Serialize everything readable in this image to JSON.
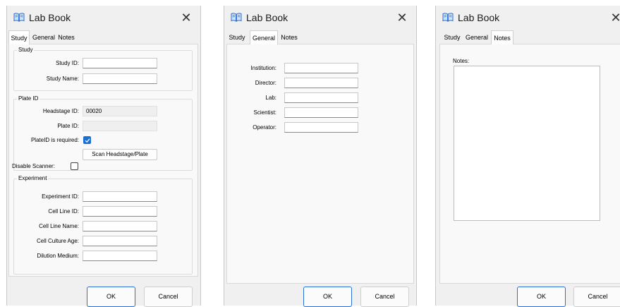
{
  "title": "Lab Book",
  "tabs": [
    "Study",
    "General",
    "Notes"
  ],
  "buttons": {
    "ok": "OK",
    "cancel": "Cancel"
  },
  "study_tab": {
    "study_group": {
      "title": "Study",
      "study_id_label": "Study ID:",
      "study_name_label": "Study Name:",
      "study_id_value": "",
      "study_name_value": ""
    },
    "plate_group": {
      "title": "Plate ID",
      "headstage_id_label": "Headstage ID:",
      "headstage_id_value": "00020",
      "plate_id_label": "Plate ID:",
      "plate_id_value": "",
      "plateid_required_label": "PlateID is required:",
      "plateid_required_checked": true,
      "scan_button": "Scan Headstage/Plate"
    },
    "disable_scanner_label": "Disable Scanner:",
    "disable_scanner_checked": false,
    "experiment_group": {
      "title": "Experiment",
      "experiment_id_label": "Experiment ID:",
      "cell_line_id_label": "Cell Line ID:",
      "cell_line_name_label": "Cell Line Name:",
      "cell_culture_age_label": "Cell Culture Age:",
      "dilution_medium_label": "Dilution Medium:"
    }
  },
  "general_tab": {
    "institution_label": "Institution:",
    "director_label": "Director:",
    "lab_label": "Lab:",
    "scientist_label": "Scientist:",
    "operator_label": "Operator:"
  },
  "notes_tab": {
    "notes_label": "Notes:",
    "notes_value": ""
  },
  "colors": {
    "accent": "#1a6fd4",
    "dialog_bg": "#f0f0f0",
    "panel_bg": "#f9f9f9"
  },
  "icons": {
    "title": "book-icon",
    "close": "close-icon",
    "check": "checkmark-icon"
  }
}
